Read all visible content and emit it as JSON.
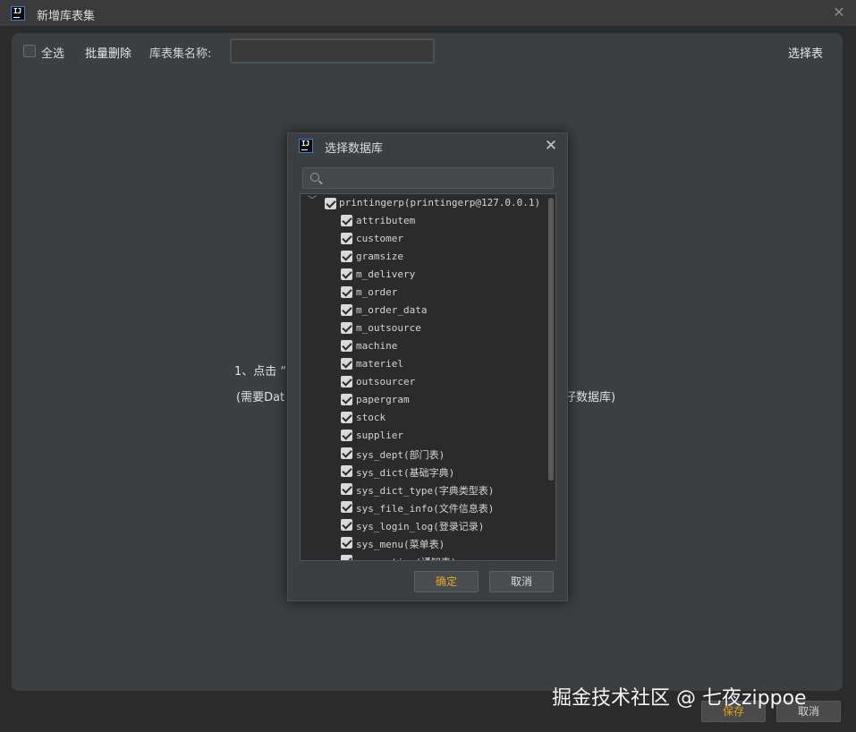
{
  "window": {
    "title": "新增库表集"
  },
  "toolbar": {
    "select_all_label": "全选",
    "batch_delete_label": "批量删除",
    "set_name_label": "库表集名称:",
    "set_name_value": "",
    "select_table_label": "选择表"
  },
  "hint": {
    "line1_visible": "1、点击 “",
    "line2_visible_left": "(需要Dat",
    "line2_visible_right": "仔数据库)"
  },
  "footer": {
    "save_label": "保存",
    "cancel_label": "取消"
  },
  "watermark": "掘金技术社区 @ 七夜zippoe",
  "dialog": {
    "title": "选择数据库",
    "search_placeholder": "",
    "root": {
      "label": "printingerp(printingerp@127.0.0.1)",
      "checked": true,
      "expanded": true
    },
    "tables": [
      {
        "label": "attributem",
        "checked": true
      },
      {
        "label": "customer",
        "checked": true
      },
      {
        "label": "gramsize",
        "checked": true
      },
      {
        "label": "m_delivery",
        "checked": true
      },
      {
        "label": "m_order",
        "checked": true
      },
      {
        "label": "m_order_data",
        "checked": true
      },
      {
        "label": "m_outsource",
        "checked": true
      },
      {
        "label": "machine",
        "checked": true
      },
      {
        "label": "materiel",
        "checked": true
      },
      {
        "label": "outsourcer",
        "checked": true
      },
      {
        "label": "papergram",
        "checked": true
      },
      {
        "label": "stock",
        "checked": true
      },
      {
        "label": "supplier",
        "checked": true
      },
      {
        "label": "sys_dept(部门表)",
        "checked": true
      },
      {
        "label": "sys_dict(基础字典)",
        "checked": true
      },
      {
        "label": "sys_dict_type(字典类型表)",
        "checked": true
      },
      {
        "label": "sys_file_info(文件信息表)",
        "checked": true
      },
      {
        "label": "sys_login_log(登录记录)",
        "checked": true
      },
      {
        "label": "sys_menu(菜单表)",
        "checked": true
      },
      {
        "label": "sys_notice(通知表)",
        "checked": true
      }
    ],
    "ok_label": "确定",
    "cancel_label": "取消"
  },
  "colors": {
    "accent_button_text": "#e0a82e",
    "background": "#2b2b2b",
    "panel": "#3c3f41"
  }
}
